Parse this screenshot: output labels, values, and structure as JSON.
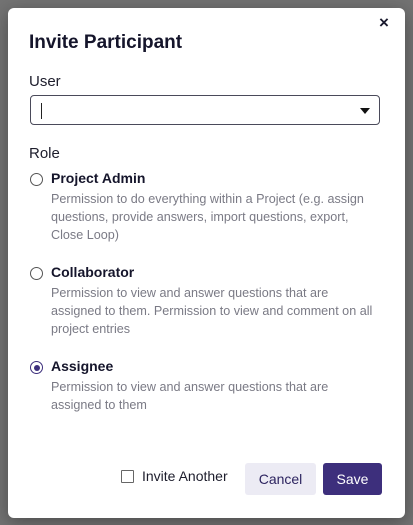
{
  "modal": {
    "title": "Invite Participant",
    "close_glyph": "×",
    "user_label": "User",
    "user_value": "",
    "role_label": "Role",
    "roles": [
      {
        "title": "Project Admin",
        "description": "Permission to do everything within a Project (e.g. assign questions, provide answers, import questions, export, Close Loop)",
        "selected": false
      },
      {
        "title": "Collaborator",
        "description": "Permission to view and answer questions that are assigned to them. Permission to view and comment on all project entries",
        "selected": false
      },
      {
        "title": "Assignee",
        "description": "Permission to view and answer questions that are assigned to them",
        "selected": true
      }
    ],
    "invite_another_label": "Invite Another",
    "invite_another_checked": false,
    "cancel_label": "Cancel",
    "save_label": "Save"
  },
  "colors": {
    "primary": "#3d2f7c",
    "cancel_bg": "#ecebf4",
    "overlay": "rgba(0,0,0,0.55)",
    "description_text": "#7a7a85"
  },
  "icons": {
    "close": "close-icon",
    "dropdown": "chevron-down-icon"
  }
}
